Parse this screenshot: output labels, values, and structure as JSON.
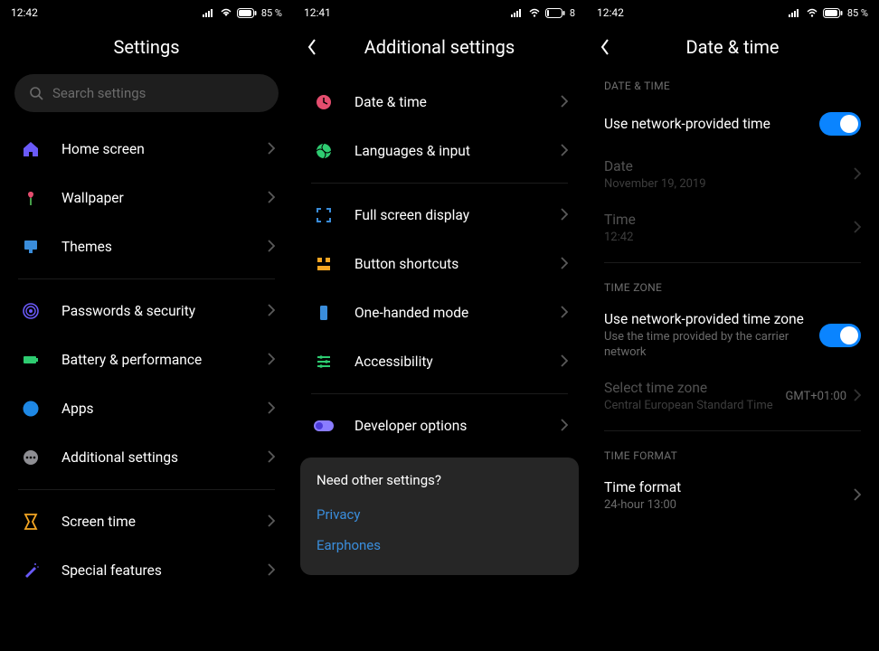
{
  "screen1": {
    "status": {
      "time": "12:42",
      "battery": "85 %"
    },
    "title": "Settings",
    "searchPlaceholder": "Search settings",
    "items": [
      {
        "label": "Home screen"
      },
      {
        "label": "Wallpaper"
      },
      {
        "label": "Themes"
      }
    ],
    "items2": [
      {
        "label": "Passwords & security"
      },
      {
        "label": "Battery & performance"
      },
      {
        "label": "Apps"
      },
      {
        "label": "Additional settings"
      }
    ],
    "items3": [
      {
        "label": "Screen time"
      },
      {
        "label": "Special features"
      }
    ]
  },
  "screen2": {
    "status": {
      "time": "12:41",
      "battery": "8"
    },
    "title": "Additional settings",
    "itemsA": [
      {
        "label": "Date & time"
      },
      {
        "label": "Languages & input"
      }
    ],
    "itemsB": [
      {
        "label": "Full screen display"
      },
      {
        "label": "Button shortcuts"
      },
      {
        "label": "One-handed mode"
      },
      {
        "label": "Accessibility"
      }
    ],
    "itemsC": [
      {
        "label": "Developer options"
      }
    ],
    "card": {
      "title": "Need other settings?",
      "link1": "Privacy",
      "link2": "Earphones"
    }
  },
  "screen3": {
    "status": {
      "time": "12:42",
      "battery": "85 %"
    },
    "title": "Date & time",
    "sectionA": "DATE & TIME",
    "rowA1": {
      "title": "Use network-provided time"
    },
    "rowA2": {
      "title": "Date",
      "sub": "November 19, 2019"
    },
    "rowA3": {
      "title": "Time",
      "sub": "12:42"
    },
    "sectionB": "TIME ZONE",
    "rowB1": {
      "title": "Use network-provided time zone",
      "sub": "Use the time provided by the carrier network"
    },
    "rowB2": {
      "title": "Select time zone",
      "sub": "Central European Standard Time",
      "right": "GMT+01:00"
    },
    "sectionC": "TIME FORMAT",
    "rowC1": {
      "title": "Time format",
      "sub": "24-hour 13:00"
    }
  }
}
